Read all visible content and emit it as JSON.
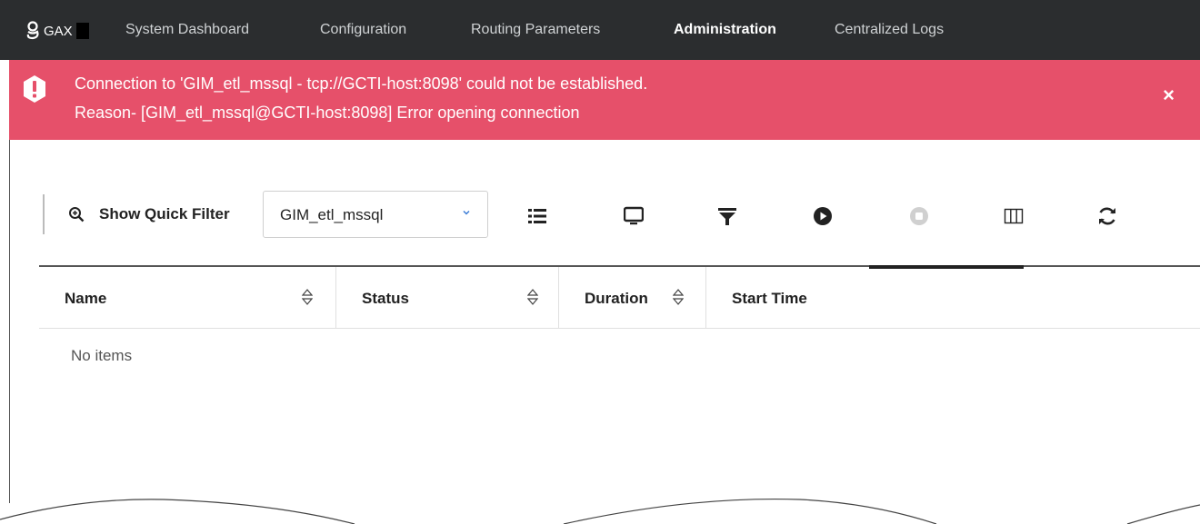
{
  "nav": {
    "logo": "GAX",
    "items": [
      {
        "label": "System Dashboard",
        "active": false
      },
      {
        "label": "Configuration",
        "active": false
      },
      {
        "label": "Routing Parameters",
        "active": false
      },
      {
        "label": "Administration",
        "active": true
      },
      {
        "label": "Centralized Logs",
        "active": false
      }
    ]
  },
  "alert": {
    "line1": "Connection to 'GIM_etl_mssql - tcp://GCTI-host:8098' could not be established.",
    "line2": "Reason- [GIM_etl_mssql@GCTI-host:8098] Error opening connection",
    "close": "×",
    "color": "#e6506a"
  },
  "toolbar": {
    "quick_filter_label": "Show Quick Filter",
    "selected_app": "GIM_etl_mssql",
    "icons": [
      "list-icon",
      "monitor-icon",
      "filter-icon",
      "play-icon",
      "stop-icon",
      "columns-icon",
      "refresh-icon"
    ]
  },
  "table": {
    "columns": [
      "Name",
      "Status",
      "Duration",
      "Start Time"
    ],
    "empty_text": "No items"
  }
}
